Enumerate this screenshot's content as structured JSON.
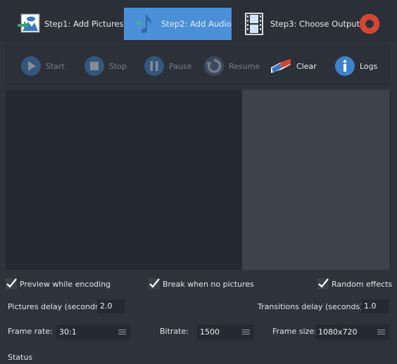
{
  "steps": [
    {
      "label": "Step1: Add Pictures",
      "icon": "add-pictures-icon",
      "active": false
    },
    {
      "label": "Step2: Add Audio",
      "icon": "add-audio-icon",
      "active": true
    },
    {
      "label": "Step3: Choose Output",
      "icon": "film-strip-icon",
      "active": false
    }
  ],
  "help_icon": "lifebuoy-icon",
  "toolbar": {
    "start": "Start",
    "stop": "Stop",
    "pause": "Pause",
    "resume": "Resume",
    "clear": "Clear",
    "logs": "Logs"
  },
  "options": {
    "preview_while_encoding": {
      "label": "Preview while encoding",
      "checked": true
    },
    "break_when_no_pictures": {
      "label": "Break when no pictures",
      "checked": true
    },
    "random_effects": {
      "label": "Random effects",
      "checked": true
    }
  },
  "settings": {
    "pictures_delay_label": "Pictures delay (seconds)",
    "pictures_delay_value": "2.0",
    "transitions_delay_label": "Transitions delay (seconds)",
    "transitions_delay_value": "1.0",
    "frame_rate_label": "Frame rate:",
    "frame_rate_value": "30:1",
    "bitrate_label": "Bitrate:",
    "bitrate_value": "1500",
    "frame_size_label": "Frame size:",
    "frame_size_value": "1080x720"
  },
  "status_label": "Status",
  "colors": {
    "accent": "#4a90d9",
    "background": "#2e323b",
    "preview_left": "#252932",
    "preview_right": "#3c434b"
  }
}
